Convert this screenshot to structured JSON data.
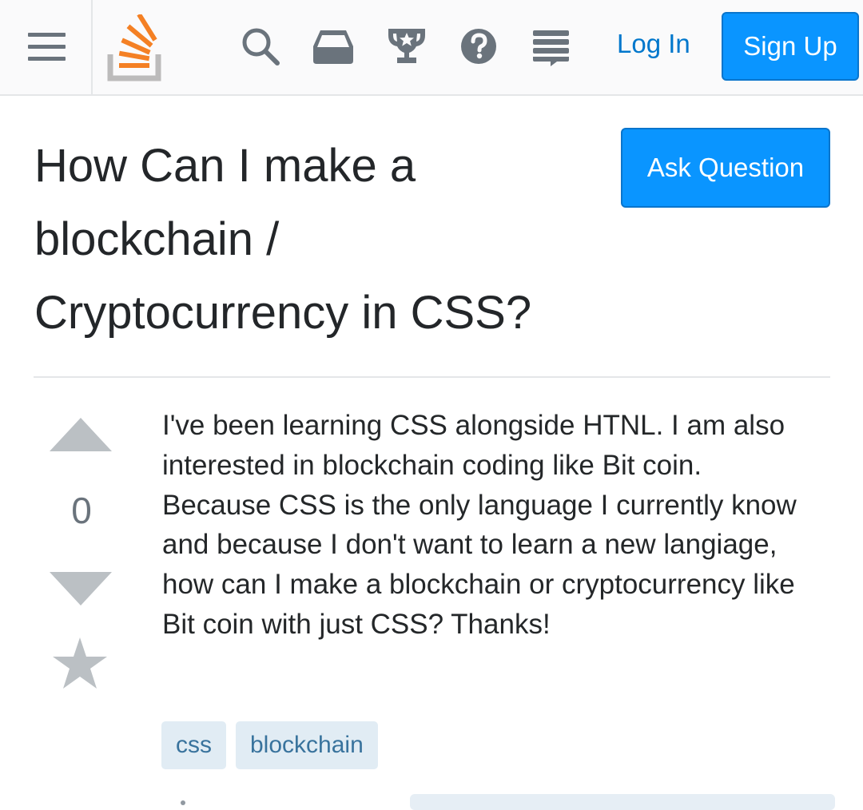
{
  "header": {
    "menu_icon": "hamburger-menu-icon",
    "logo_icon": "stackoverflow-logo-icon",
    "icons": [
      "search-icon",
      "inbox-icon",
      "trophy-icon",
      "help-icon",
      "chat-icon"
    ],
    "login_label": "Log In",
    "signup_label": "Sign Up"
  },
  "question": {
    "title": "How Can I make a blockchain / Cryptocurrency in CSS?",
    "ask_button_label": "Ask Question",
    "vote_count": "0",
    "body": "I've been learning CSS alongside HTNL. I am also interested in blockchain coding like Bit coin. Because CSS is the only language I currently know and because I don't want to learn a new langiage, how can I make a blockchain or cryptocurrency like Bit coin with just CSS? Thanks!",
    "tags": [
      "css",
      "blockchain"
    ]
  },
  "colors": {
    "primary_button": "#0a95ff",
    "link": "#0077cc",
    "logo_orange": "#f48024",
    "logo_gray": "#bcbbbb",
    "tag_bg": "#e1ecf4",
    "tag_text": "#39739d",
    "icon_gray": "#6a737c",
    "vote_gray": "#bbc0c4"
  }
}
